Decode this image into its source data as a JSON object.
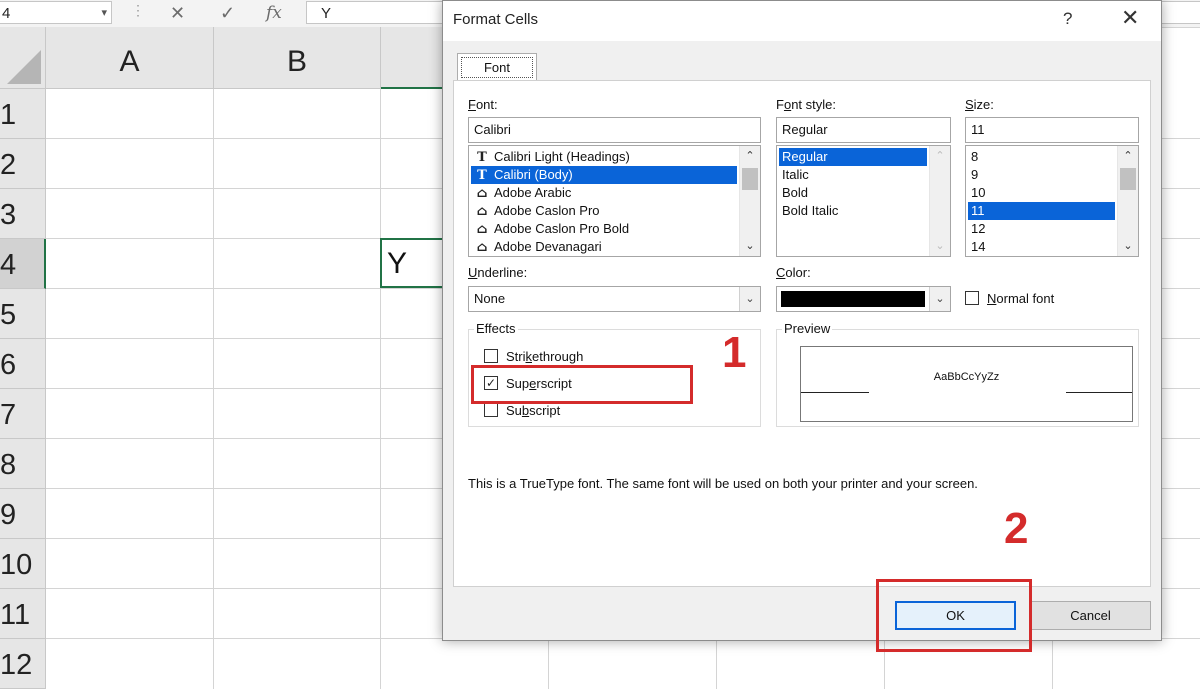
{
  "formula_bar": {
    "name_box": "4",
    "dropdown_glyph": "▾",
    "separator": "⋮",
    "cancel_icon": "✕",
    "enter_icon": "✓",
    "fx_label": "fx",
    "content": "Y"
  },
  "grid": {
    "columns": [
      "A",
      "B"
    ],
    "rows": [
      "1",
      "2",
      "3",
      "4",
      "5",
      "6",
      "7",
      "8",
      "9",
      "10",
      "11",
      "12"
    ],
    "active_cell_value": "Y"
  },
  "dialog": {
    "title": "Format Cells",
    "help": "?",
    "close": "✕",
    "tab": "Font",
    "font_label_u": "F",
    "font_label_rest": "ont:",
    "font_value": "Calibri",
    "font_list": [
      {
        "icon": "T",
        "name": "Calibri Light (Headings)"
      },
      {
        "icon": "T",
        "name": "Calibri (Body)"
      },
      {
        "icon": "⌂",
        "name": "Adobe Arabic"
      },
      {
        "icon": "⌂",
        "name": "Adobe Caslon Pro"
      },
      {
        "icon": "⌂",
        "name": "Adobe Caslon Pro Bold"
      },
      {
        "icon": "⌂",
        "name": "Adobe Devanagari"
      }
    ],
    "style_label_pre": "F",
    "style_label_u": "o",
    "style_label_rest": "nt style:",
    "style_value": "Regular",
    "style_list": [
      "Regular",
      "Italic",
      "Bold",
      "Bold Italic"
    ],
    "size_label_u": "S",
    "size_label_rest": "ize:",
    "size_value": "11",
    "size_list": [
      "8",
      "9",
      "10",
      "11",
      "12",
      "14"
    ],
    "underline_label_u": "U",
    "underline_label_rest": "nderline:",
    "underline_value": "None",
    "color_label_u": "C",
    "color_label_rest": "olor:",
    "color_value_hex": "#000000",
    "normal_font_u": "N",
    "normal_font_rest": "ormal font",
    "effects_title": "Effects",
    "strike_pre": "Stri",
    "strike_u": "k",
    "strike_rest": "ethrough",
    "super_pre": "Sup",
    "super_u": "e",
    "super_rest": "rscript",
    "sub_pre": "Su",
    "sub_u": "b",
    "sub_rest": "script",
    "preview_title": "Preview",
    "preview_text": "AaBbCcYyZz",
    "info": "This is a TrueType font.  The same font will be used on both your printer and your screen.",
    "ok": "OK",
    "cancel": "Cancel"
  },
  "annotations": {
    "step1": "1",
    "step2": "2",
    "color": "#d42b2b"
  },
  "colors": {
    "excel_green": "#217346",
    "selection_blue": "#0a64d8"
  }
}
